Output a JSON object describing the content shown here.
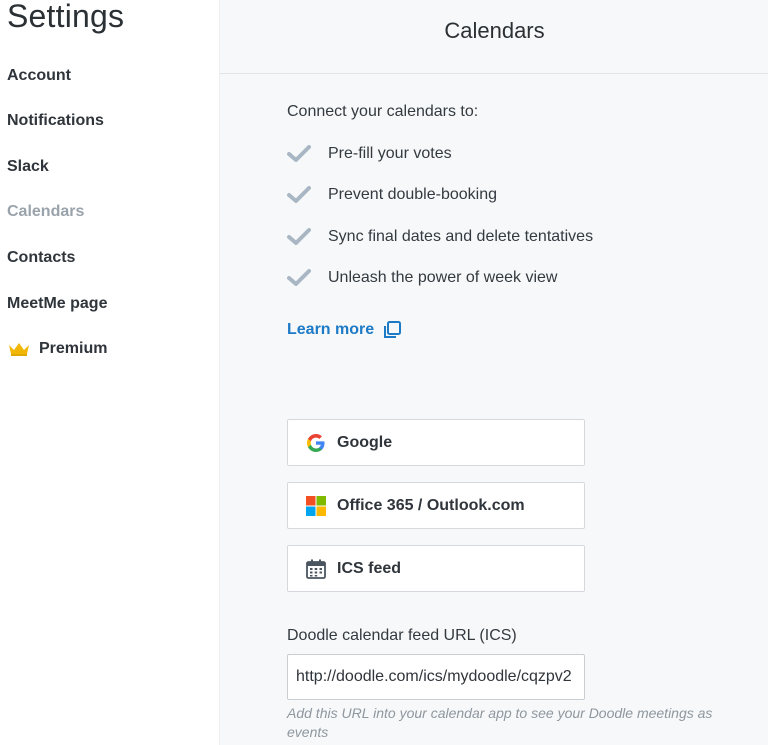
{
  "sidebar": {
    "title": "Settings",
    "items": [
      {
        "label": "Account",
        "active": false
      },
      {
        "label": "Notifications",
        "active": false
      },
      {
        "label": "Slack",
        "active": false
      },
      {
        "label": "Calendars",
        "active": true
      },
      {
        "label": "Contacts",
        "active": false
      },
      {
        "label": "MeetMe page",
        "active": false
      },
      {
        "label": "Premium",
        "icon": "crown-icon",
        "active": false
      }
    ]
  },
  "main": {
    "title": "Calendars",
    "intro": "Connect your calendars to:",
    "benefits": [
      "Pre-fill your votes",
      "Prevent double-booking",
      "Sync final dates and delete tentatives",
      "Unleash the power of week view"
    ],
    "learn_more": "Learn more",
    "calendars": [
      {
        "label": "Google",
        "icon": "google-icon"
      },
      {
        "label": "Office 365 / Outlook.com",
        "icon": "microsoft-icon"
      },
      {
        "label": "ICS feed",
        "icon": "calendar-icon"
      }
    ],
    "feed": {
      "label": "Doodle calendar feed URL (ICS)",
      "value": "http://doodle.com/ics/mydoodle/cqzpv2",
      "help": "Add this URL into your calendar app to see your Doodle meetings as events"
    }
  },
  "colors": {
    "accent_link": "#1d7ac6",
    "active_nav": "#9aa3ab",
    "check": "#a9b7c4",
    "crown": "#f2b705"
  }
}
